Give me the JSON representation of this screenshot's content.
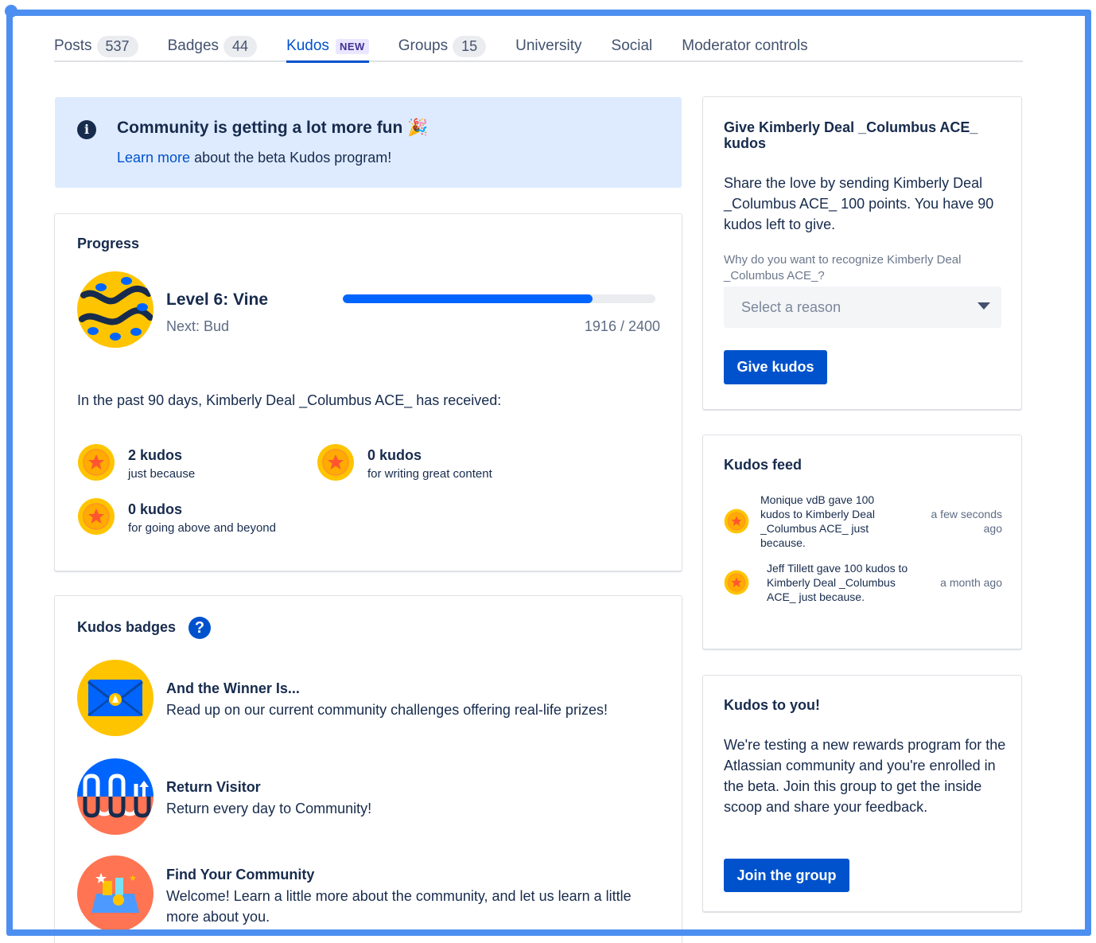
{
  "tabs": [
    {
      "label": "Posts",
      "count": "537"
    },
    {
      "label": "Badges",
      "count": "44"
    },
    {
      "label": "Kudos",
      "badge": "NEW"
    },
    {
      "label": "Groups",
      "count": "15"
    },
    {
      "label": "University"
    },
    {
      "label": "Social"
    },
    {
      "label": "Moderator controls"
    }
  ],
  "banner": {
    "title": "Community is getting a lot more fun",
    "emoji": "🎉",
    "link": "Learn more",
    "desc": " about the beta Kudos program!"
  },
  "progress": {
    "title": "Progress",
    "level": "Level 6: Vine",
    "next": "Next: Bud",
    "current": 1916,
    "total": 2400,
    "label": "1916 / 2400",
    "past_text": "In the past 90 days, Kimberly Deal _Columbus ACE_ has received:",
    "stats": [
      {
        "count": "2 kudos",
        "reason": "just because"
      },
      {
        "count": "0 kudos",
        "reason": "for writing great content"
      },
      {
        "count": "0 kudos",
        "reason": "for going above and beyond"
      }
    ]
  },
  "badges": {
    "title": "Kudos badges",
    "help": "?",
    "items": [
      {
        "name": "And the Winner Is...",
        "desc": "Read up on our current community challenges offering real-life prizes!"
      },
      {
        "name": "Return Visitor",
        "desc": "Return every day to Community!"
      },
      {
        "name": "Find Your Community",
        "desc": "Welcome! Learn a little more about the community, and let us learn a little more about you."
      }
    ]
  },
  "give": {
    "title": "Give Kimberly Deal _Columbus ACE_ kudos",
    "share": "Share the love by sending Kimberly Deal _Columbus ACE_ 100 points. You have 90 kudos left to give.",
    "why": "Why do you want to recognize Kimberly Deal _Columbus ACE_?",
    "select_placeholder": "Select a reason",
    "button": "Give kudos"
  },
  "feed": {
    "title": "Kudos feed",
    "items": [
      {
        "text": "Monique vdB gave 100 kudos to Kimberly Deal _Columbus ACE_ just because.",
        "time": "a few seconds ago"
      },
      {
        "text": "Jeff Tillett gave 100 kudos to Kimberly Deal _Columbus ACE_ just because.",
        "time": "a month ago"
      }
    ]
  },
  "you": {
    "title": "Kudos to you!",
    "text": "We're testing a new rewards program for the Atlassian community and you're enrolled in the beta. Join this group to get the inside scoop and share your feedback.",
    "button": "Join the group"
  },
  "colors": {
    "accent": "#0052cc",
    "progress": "#0065ff",
    "coin": "#ffc400",
    "frame": "#4c8ff0"
  }
}
